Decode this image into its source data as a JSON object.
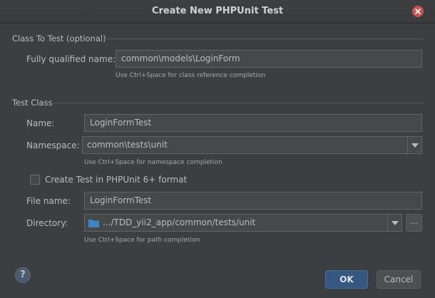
{
  "window": {
    "title": "Create New PHPUnit Test"
  },
  "class_to_test": {
    "section_label": "Class To Test (optional)",
    "fqn_label": "Fully qualified name:",
    "fqn_value": "common\\models\\LoginForm",
    "fqn_hint": "Use Ctrl+Space for class reference completion"
  },
  "test_class": {
    "section_label": "Test Class",
    "name_label": "Name:",
    "name_value": "LoginFormTest",
    "namespace_label": "Namespace:",
    "namespace_value": "common\\tests\\unit",
    "namespace_hint": "Use Ctrl+Space for namespace completion",
    "phpunit6_label": "Create Test in PHPUnit 6+ format",
    "phpunit6_checked": false,
    "file_name_label": "File name:",
    "file_name_value": "LoginFormTest",
    "directory_label": "Directory:",
    "directory_value": ".../TDD_yii2_app/common/tests/unit",
    "directory_hint": "Use Ctrl+Space for path completion",
    "browse_label": "..."
  },
  "footer": {
    "help_label": "?",
    "ok_label": "OK",
    "cancel_label": "Cancel"
  },
  "colors": {
    "background": "#3c3f41",
    "field_background": "#45494a",
    "ok_button": "#365880",
    "close_button": "#c75450",
    "folder_icon": "#3d86c6"
  },
  "icons": [
    "close-icon",
    "chevron-down-icon",
    "folder-icon",
    "help-icon"
  ]
}
